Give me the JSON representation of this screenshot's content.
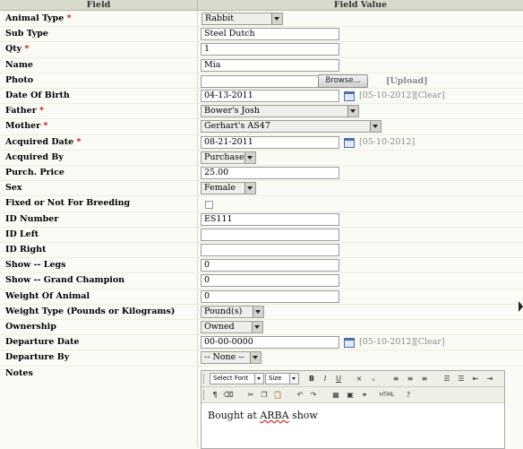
{
  "header": {
    "field_col": "Field",
    "value_col": "Field Value"
  },
  "required_mark": "*",
  "rows": {
    "animal_type": {
      "label": "Animal Type",
      "value": "Rabbit"
    },
    "sub_type": {
      "label": "Sub Type",
      "value": "Steel Dutch"
    },
    "qty": {
      "label": "Qty",
      "value": "1"
    },
    "name": {
      "label": "Name",
      "value": "Mia"
    },
    "photo": {
      "label": "Photo",
      "browse": "Browse...",
      "upload": "[Upload]"
    },
    "dob": {
      "label": "Date Of Birth",
      "value": "04-13-2011",
      "today": "[05-10-2012]",
      "clear": "[Clear]"
    },
    "father": {
      "label": "Father",
      "value": "Bower's Josh"
    },
    "mother": {
      "label": "Mother",
      "value": "Gerhart's AS47"
    },
    "acquired_date": {
      "label": "Acquired Date",
      "value": "08-21-2011",
      "today": "[05-10-2012]"
    },
    "acquired_by": {
      "label": "Acquired By",
      "value": "Purchase"
    },
    "price": {
      "label": "Purch. Price",
      "value": "25.00"
    },
    "sex": {
      "label": "Sex",
      "value": "Female"
    },
    "fixed": {
      "label": "Fixed or Not For Breeding",
      "checked": false
    },
    "id_number": {
      "label": "ID Number",
      "value": "ES111"
    },
    "id_left": {
      "label": "ID Left",
      "value": ""
    },
    "id_right": {
      "label": "ID Right",
      "value": ""
    },
    "show_legs": {
      "label": "Show -- Legs",
      "value": "0"
    },
    "show_gc": {
      "label": "Show -- Grand Champion",
      "value": "0"
    },
    "weight": {
      "label": "Weight Of Animal",
      "value": "0"
    },
    "weight_type": {
      "label": "Weight Type (Pounds or Kilograms)",
      "value": "Pound(s)"
    },
    "ownership": {
      "label": "Ownership",
      "value": "Owned"
    },
    "departure_date": {
      "label": "Departure Date",
      "value": "00-00-0000",
      "today": "[05-10-2012]",
      "clear": "[Clear]"
    },
    "departure_by": {
      "label": "Departure By",
      "value": "-- None --"
    },
    "notes": {
      "label": "Notes",
      "value": "Bought at ",
      "value_misspelled": "ARBA",
      "value_rest": " show"
    }
  },
  "editor": {
    "font_select": "Select Font",
    "size_select": "Size",
    "bold": "B",
    "italic": "I",
    "underline": "U",
    "html": "HTML"
  },
  "colors": {
    "header_bg": "#d9d9cc",
    "required": "#d00000",
    "link_gray": "#888888",
    "page_bg": "#fbfbf6"
  }
}
